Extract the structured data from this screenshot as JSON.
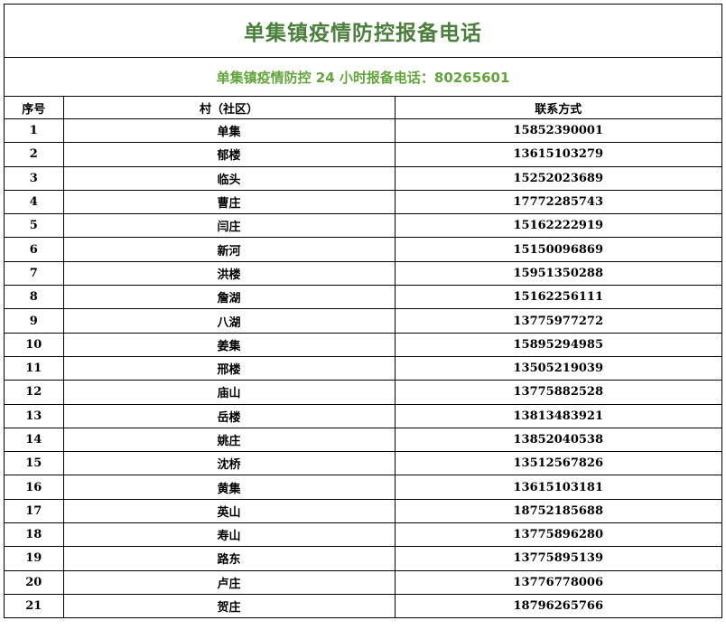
{
  "title": "单集镇疫情防控报备电话",
  "subtitle": "单集镇疫情防控 24 小时报备电话：80265601",
  "table": {
    "headers": [
      "序号",
      "村（社区）",
      "联系方式"
    ],
    "rows": [
      [
        "1",
        "单集",
        "15852390001"
      ],
      [
        "2",
        "郁楼",
        "13615103279"
      ],
      [
        "3",
        "临头",
        "15252023689"
      ],
      [
        "4",
        "曹庄",
        "17772285743"
      ],
      [
        "5",
        "闫庄",
        "15162222919"
      ],
      [
        "6",
        "新河",
        "15150096869"
      ],
      [
        "7",
        "洪楼",
        "15951350288"
      ],
      [
        "8",
        "詹湖",
        "15162256111"
      ],
      [
        "9",
        "八湖",
        "13775977272"
      ],
      [
        "10",
        "姜集",
        "15895294985"
      ],
      [
        "11",
        "邢楼",
        "13505219039"
      ],
      [
        "12",
        "庙山",
        "13775882528"
      ],
      [
        "13",
        "岳楼",
        "13813483921"
      ],
      [
        "14",
        "姚庄",
        "13852040538"
      ],
      [
        "15",
        "沈桥",
        "13512567826"
      ],
      [
        "16",
        "黄集",
        "13615103181"
      ],
      [
        "17",
        "英山",
        "18752185688"
      ],
      [
        "18",
        "寿山",
        "13775896280"
      ],
      [
        "19",
        "路东",
        "13775895139"
      ],
      [
        "20",
        "卢庄",
        "13776778006"
      ],
      [
        "21",
        "贺庄",
        "18796265766"
      ]
    ]
  }
}
